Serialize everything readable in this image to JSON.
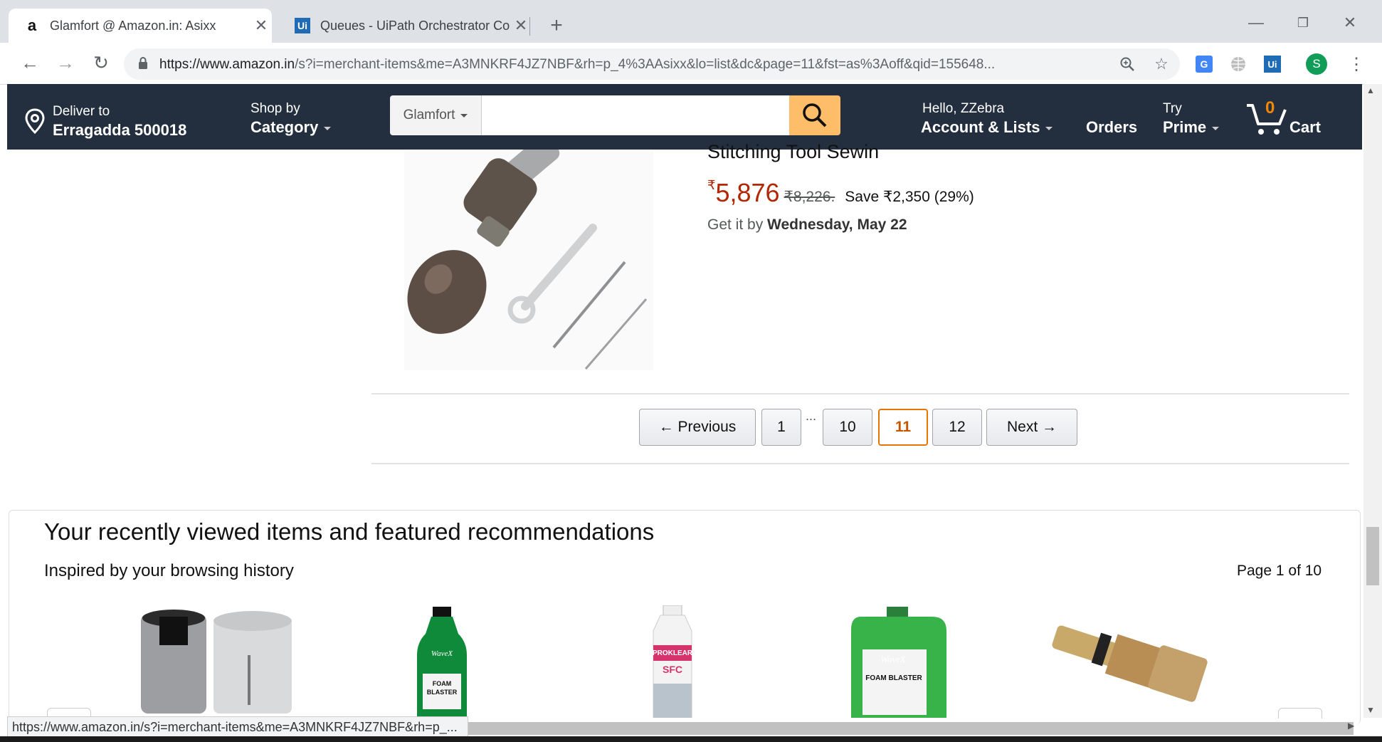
{
  "browser": {
    "tabs": [
      {
        "favicon": "a",
        "title": "Glamfort @ Amazon.in: Asixx",
        "active": true
      },
      {
        "favicon": "Ui",
        "title": "Queues - UiPath Orchestrator Co",
        "active": false
      }
    ],
    "url_prefix": "https://www.amazon.in",
    "url_rest": "/s?i=merchant-items&me=A3MNKRF4JZ7NBF&rh=p_4%3AAsixx&lo=list&dc&page=11&fst=as%3Aoff&qid=155648...",
    "profile_initial": "S",
    "status_url": "https://www.amazon.in/s?i=merchant-items&me=A3MNKRF4JZ7NBF&rh=p_..."
  },
  "header": {
    "deliver_label": "Deliver to",
    "deliver_location": "Erragadda 500018",
    "shop_by": "Shop by",
    "category": "Category",
    "search_dept": "Glamfort",
    "hello": "Hello, ZZebra",
    "account_lists": "Account & Lists",
    "orders": "Orders",
    "try": "Try",
    "prime": "Prime",
    "cart_count": "0",
    "cart": "Cart"
  },
  "product": {
    "title": "Stitching Tool Sewin",
    "price_symbol": "₹",
    "price": "5,876",
    "price_old": "₹8,226.",
    "save": "Save ₹2,350 (29%)",
    "delivery_prefix": "Get it by",
    "delivery_date": "Wednesday, May 22"
  },
  "pagination": {
    "previous": "←  Previous",
    "p1": "1",
    "ellipsis": "...",
    "p10": "10",
    "p11": "11",
    "p12": "12",
    "next": "Next  →"
  },
  "recommendations": {
    "title": "Your recently viewed items and featured recommendations",
    "subtitle": "Inspired by your browsing history",
    "page": "Page 1 of 10",
    "item2_brand": "WaveX",
    "item2_label": "FOAM BLASTER",
    "item3_brand": "PROKLEAR",
    "item3_label": "SFC",
    "item4_brand": "WaveX",
    "item4_label": "FOAM BLASTER"
  }
}
